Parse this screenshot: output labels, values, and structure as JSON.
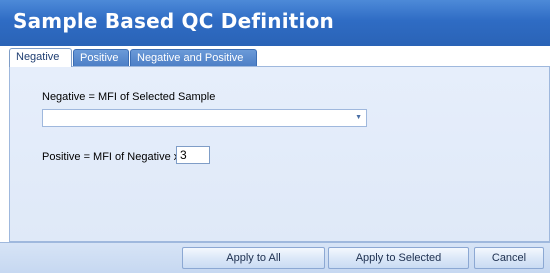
{
  "window": {
    "title": "Sample Based QC Definition"
  },
  "tabs": [
    {
      "label": "Negative",
      "active": true
    },
    {
      "label": "Positive",
      "active": false
    },
    {
      "label": "Negative and Positive",
      "active": false
    }
  ],
  "negative": {
    "label": "Negative = MFI of Selected Sample",
    "selected_value": ""
  },
  "positive": {
    "label": "Positive = MFI of Negative x",
    "multiplier": "3"
  },
  "buttons": {
    "apply_all": "Apply to All",
    "apply_selected": "Apply to Selected",
    "cancel": "Cancel"
  },
  "colors": {
    "header": "#2f6cc4",
    "panel": "#e2ebf9",
    "tab_inactive": "#5a8bd0"
  }
}
